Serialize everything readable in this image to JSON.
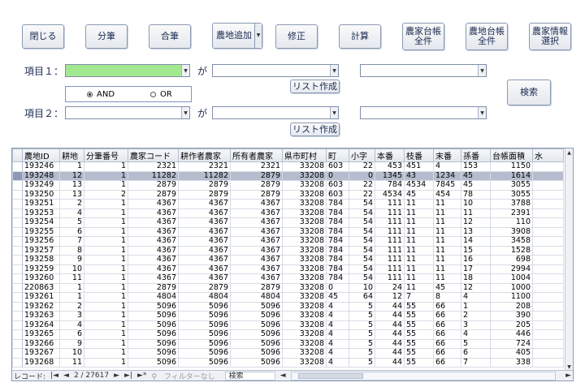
{
  "toolbar": {
    "close": "閉じる",
    "split": "分筆",
    "merge": "合筆",
    "add_land": "農地追加",
    "edit": "修正",
    "calc": "計算",
    "farmer_ledger_all": "農家台帳\n全件",
    "land_ledger_all": "農地台帳\n全件",
    "farmer_info_select": "農家情報\n選択"
  },
  "filter": {
    "item1_label": "項目１：",
    "item2_label": "項目２：",
    "ga": "が",
    "list_create": "リスト作成",
    "and_label": "AND",
    "or_label": "OR",
    "search": "検索"
  },
  "grid": {
    "headers": [
      "農地ID",
      "耕地",
      "分筆番号",
      "農家コード",
      "耕作者農家",
      "所有者農家",
      "県市町村",
      "町",
      "小字",
      "本番",
      "枝番",
      "末番",
      "孫番",
      "台帳面積",
      "水"
    ],
    "rows": [
      [
        "193246",
        "1",
        "1",
        "2321",
        "2321",
        "2321",
        "33208",
        "603",
        "22",
        "453",
        "451",
        "4",
        "153",
        "1150",
        ""
      ],
      [
        "193248",
        "12",
        "1",
        "11282",
        "11282",
        "2879",
        "33208",
        "0",
        "0",
        "1345",
        "43",
        "1234",
        "45",
        "1614",
        ""
      ],
      [
        "193249",
        "13",
        "1",
        "2879",
        "2879",
        "2879",
        "33208",
        "603",
        "22",
        "784",
        "4534",
        "7845",
        "45",
        "3055",
        ""
      ],
      [
        "193250",
        "13",
        "2",
        "2879",
        "2879",
        "2879",
        "33208",
        "603",
        "22",
        "4534",
        "45",
        "454",
        "78",
        "3055",
        ""
      ],
      [
        "193251",
        "2",
        "1",
        "4367",
        "4367",
        "4367",
        "33208",
        "784",
        "54",
        "111",
        "11",
        "11",
        "10",
        "3788",
        ""
      ],
      [
        "193253",
        "4",
        "1",
        "4367",
        "4367",
        "4367",
        "33208",
        "784",
        "54",
        "111",
        "11",
        "11",
        "11",
        "2391",
        ""
      ],
      [
        "193254",
        "5",
        "1",
        "4367",
        "4367",
        "4367",
        "33208",
        "784",
        "54",
        "111",
        "11",
        "11",
        "12",
        "110",
        ""
      ],
      [
        "193255",
        "6",
        "1",
        "4367",
        "4367",
        "4367",
        "33208",
        "784",
        "54",
        "111",
        "11",
        "11",
        "13",
        "3908",
        ""
      ],
      [
        "193256",
        "7",
        "1",
        "4367",
        "4367",
        "4367",
        "33208",
        "784",
        "54",
        "111",
        "11",
        "11",
        "14",
        "3458",
        ""
      ],
      [
        "193257",
        "8",
        "1",
        "4367",
        "4367",
        "4367",
        "33208",
        "784",
        "54",
        "111",
        "11",
        "11",
        "15",
        "1528",
        ""
      ],
      [
        "193258",
        "9",
        "1",
        "4367",
        "4367",
        "4367",
        "33208",
        "784",
        "54",
        "111",
        "11",
        "11",
        "16",
        "698",
        ""
      ],
      [
        "193259",
        "10",
        "1",
        "4367",
        "4367",
        "4367",
        "33208",
        "784",
        "54",
        "111",
        "11",
        "11",
        "17",
        "2994",
        ""
      ],
      [
        "193260",
        "11",
        "1",
        "4367",
        "4367",
        "4367",
        "33208",
        "784",
        "54",
        "111",
        "11",
        "11",
        "18",
        "1004",
        ""
      ],
      [
        "220863",
        "1",
        "1",
        "2879",
        "2879",
        "2879",
        "33208",
        "0",
        "10",
        "24",
        "11",
        "45",
        "12",
        "1000",
        ""
      ],
      [
        "193261",
        "1",
        "1",
        "4804",
        "4804",
        "4804",
        "33208",
        "45",
        "64",
        "12",
        "7",
        "8",
        "4",
        "1100",
        ""
      ],
      [
        "193262",
        "2",
        "1",
        "5096",
        "5096",
        "5096",
        "33208",
        "4",
        "5",
        "44",
        "55",
        "66",
        "1",
        "208",
        ""
      ],
      [
        "193263",
        "3",
        "1",
        "5096",
        "5096",
        "5096",
        "33208",
        "4",
        "5",
        "44",
        "55",
        "66",
        "2",
        "390",
        ""
      ],
      [
        "193264",
        "4",
        "1",
        "5096",
        "5096",
        "5096",
        "33208",
        "4",
        "5",
        "44",
        "55",
        "66",
        "3",
        "205",
        ""
      ],
      [
        "193265",
        "6",
        "1",
        "5096",
        "5096",
        "5096",
        "33208",
        "4",
        "5",
        "44",
        "55",
        "66",
        "4",
        "446",
        ""
      ],
      [
        "193266",
        "9",
        "1",
        "5096",
        "5096",
        "5096",
        "33208",
        "4",
        "5",
        "44",
        "55",
        "66",
        "5",
        "724",
        ""
      ],
      [
        "193267",
        "10",
        "1",
        "5096",
        "5096",
        "5096",
        "33208",
        "4",
        "5",
        "44",
        "55",
        "66",
        "6",
        "405",
        ""
      ],
      [
        "193268",
        "11",
        "1",
        "5096",
        "5096",
        "5096",
        "33208",
        "4",
        "5",
        "44",
        "55",
        "66",
        "7",
        "338",
        ""
      ]
    ]
  },
  "status": {
    "label": "レコード:",
    "position": "2 / 27617",
    "no_filter": "フィルターなし",
    "search": "検索"
  }
}
